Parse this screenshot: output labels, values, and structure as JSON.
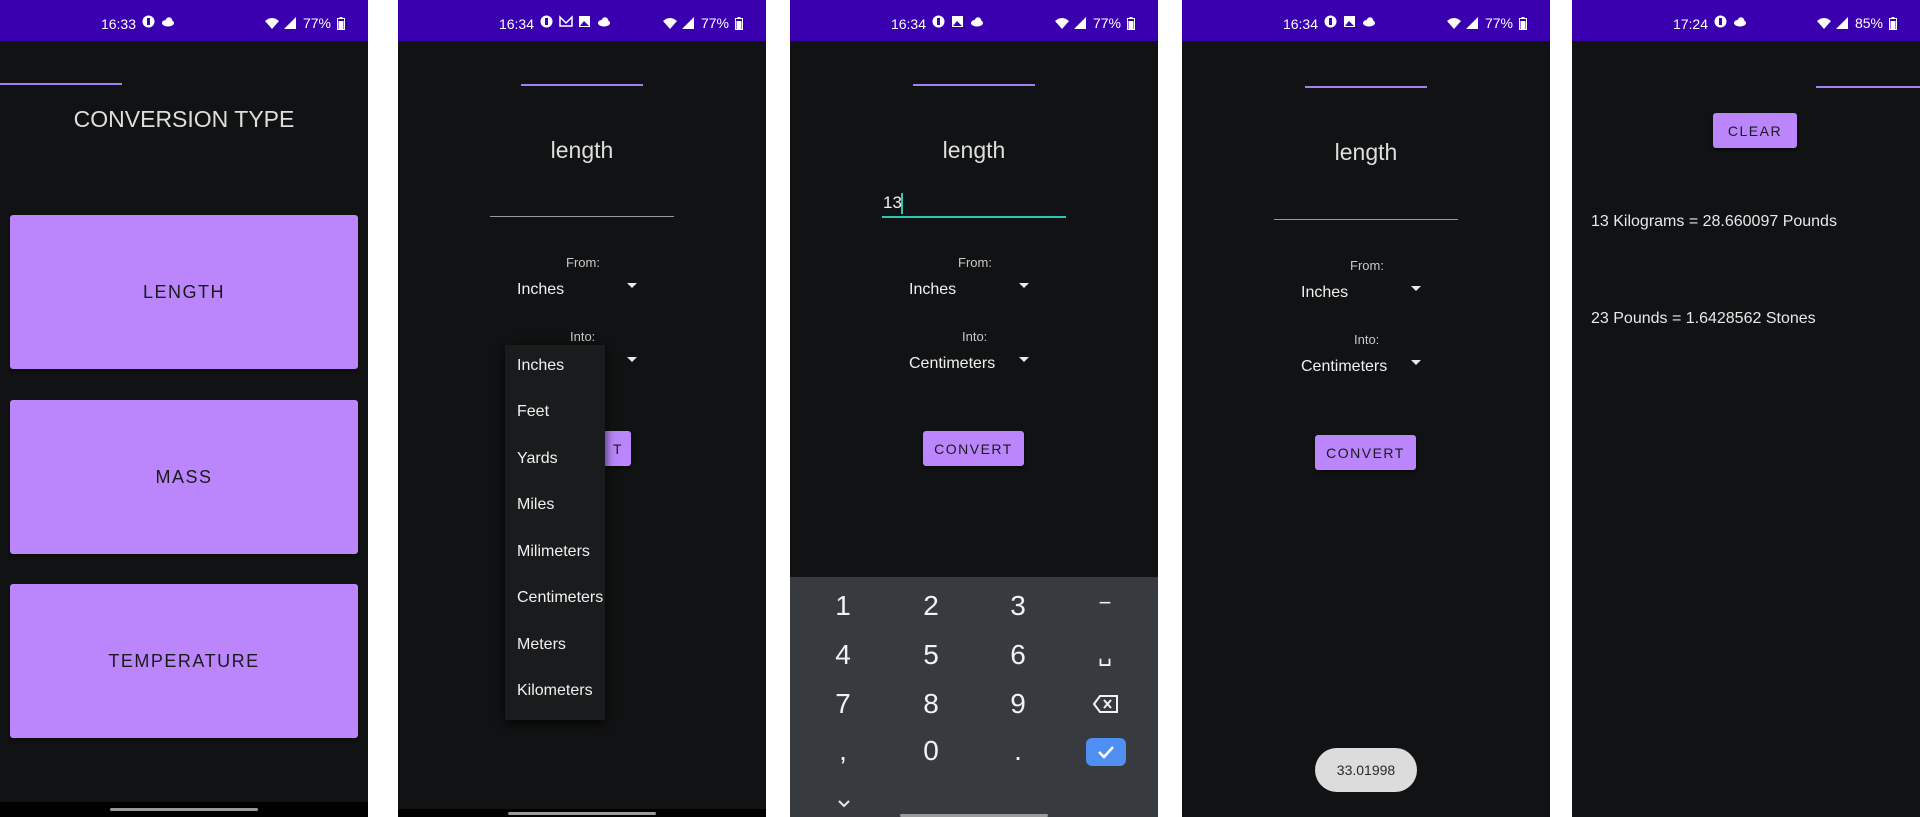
{
  "screen1": {
    "status": {
      "time": "16:33",
      "battery": "77%"
    },
    "title": "CONVERSION TYPE",
    "buttons": [
      "LENGTH",
      "MASS",
      "TEMPERATURE"
    ]
  },
  "screen2": {
    "status": {
      "time": "16:34",
      "battery": "77%"
    },
    "title": "length",
    "from_label": "From:",
    "from_value": "Inches",
    "into_label": "Into:",
    "button_partial": "T",
    "dropdown_options": [
      "Inches",
      "Feet",
      "Yards",
      "Miles",
      "Milimeters",
      "Centimeters",
      "Meters",
      "Kilometers"
    ]
  },
  "screen3": {
    "status": {
      "time": "16:34",
      "battery": "77%"
    },
    "title": "length",
    "input_value": "13",
    "from_label": "From:",
    "from_value": "Inches",
    "into_label": "Into:",
    "into_value": "Centimeters",
    "convert_label": "CONVERT",
    "keypad": {
      "row1": [
        "1",
        "2",
        "3",
        "−"
      ],
      "row2": [
        "4",
        "5",
        "6",
        "␣"
      ],
      "row3": [
        "7",
        "8",
        "9"
      ],
      "row4": [
        ",",
        "0",
        "."
      ]
    }
  },
  "screen4": {
    "status": {
      "time": "16:34",
      "battery": "77%"
    },
    "title": "length",
    "from_label": "From:",
    "from_value": "Inches",
    "into_label": "Into:",
    "into_value": "Centimeters",
    "convert_label": "CONVERT",
    "toast": "33.01998"
  },
  "screen5": {
    "status": {
      "time": "17:24",
      "battery": "85%"
    },
    "clear_label": "CLEAR",
    "results": [
      "13 Kilograms = 28.660097 Pounds",
      "23 Pounds = 1.6428562 Stones"
    ]
  },
  "colors": {
    "accent": "#bb86fc",
    "statusbar": "#3a00b0",
    "background": "#111213",
    "keypad": "#373b40",
    "check": "#4f8ff2"
  }
}
